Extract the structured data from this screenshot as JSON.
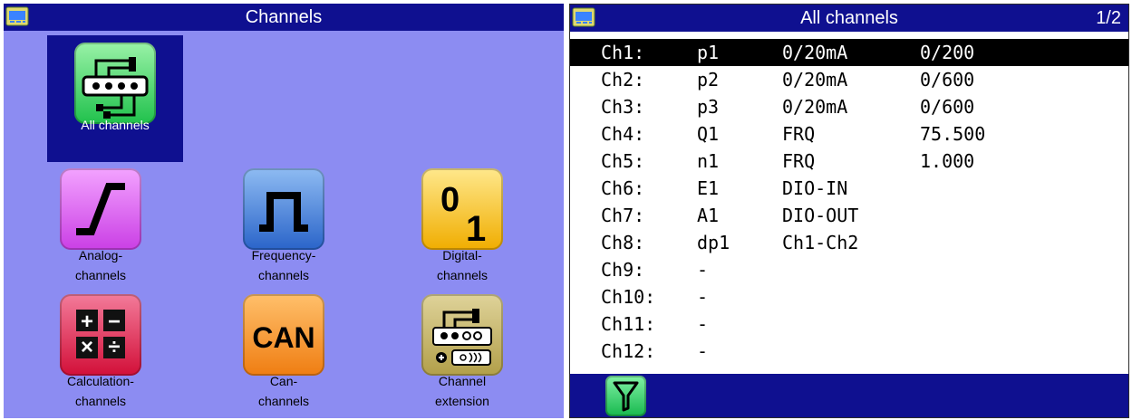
{
  "left_panel": {
    "title": "Channels",
    "app_icon": "channels-app-icon",
    "tiles": [
      {
        "label": "All channels",
        "icon": "all-channels-icon"
      },
      {
        "label": "Analog-\nchannels",
        "icon": "analog-channels-icon"
      },
      {
        "label": "Frequency-\nchannels",
        "icon": "frequency-channels-icon"
      },
      {
        "label": "Digital-\nchannels",
        "icon": "digital-channels-icon"
      },
      {
        "label": "Calculation-\nchannels",
        "icon": "calculation-channels-icon"
      },
      {
        "label": "Can-\nchannels",
        "icon": "can-channels-icon"
      },
      {
        "label": "Channel\nextension",
        "icon": "channel-extension-icon"
      }
    ],
    "icon_text": {
      "digital_0": "0",
      "digital_1": "1",
      "calc_plus": "+",
      "calc_minus": "−",
      "calc_times": "×",
      "calc_divide": "÷",
      "can": "CAN"
    }
  },
  "right_panel": {
    "title": "All channels",
    "page": "1/2",
    "app_icon": "channels-app-icon",
    "rows": [
      {
        "channel": "Ch1:",
        "name": "p1",
        "type": "0/20mA",
        "value": "0/200",
        "selected": true
      },
      {
        "channel": "Ch2:",
        "name": "p2",
        "type": "0/20mA",
        "value": "0/600"
      },
      {
        "channel": "Ch3:",
        "name": "p3",
        "type": "0/20mA",
        "value": "0/600"
      },
      {
        "channel": "Ch4:",
        "name": "Q1",
        "type": "FRQ",
        "value": "75.500"
      },
      {
        "channel": "Ch5:",
        "name": "n1",
        "type": "FRQ",
        "value": "1.000"
      },
      {
        "channel": "Ch6:",
        "name": "E1",
        "type": "DIO-IN",
        "value": ""
      },
      {
        "channel": "Ch7:",
        "name": "A1",
        "type": "DIO-OUT",
        "value": ""
      },
      {
        "channel": "Ch8:",
        "name": "dp1",
        "type": "Ch1-Ch2",
        "value": ""
      },
      {
        "channel": "Ch9:",
        "name": "-",
        "type": "",
        "value": ""
      },
      {
        "channel": "Ch10:",
        "name": "-",
        "type": "",
        "value": ""
      },
      {
        "channel": "Ch11:",
        "name": "-",
        "type": "",
        "value": ""
      },
      {
        "channel": "Ch12:",
        "name": "-",
        "type": "",
        "value": ""
      }
    ],
    "filter_icon": "filter-icon"
  },
  "colors": {
    "title_bar": "#0f1090",
    "left_background": "#8c8cf2",
    "selected_row": "#000000"
  }
}
